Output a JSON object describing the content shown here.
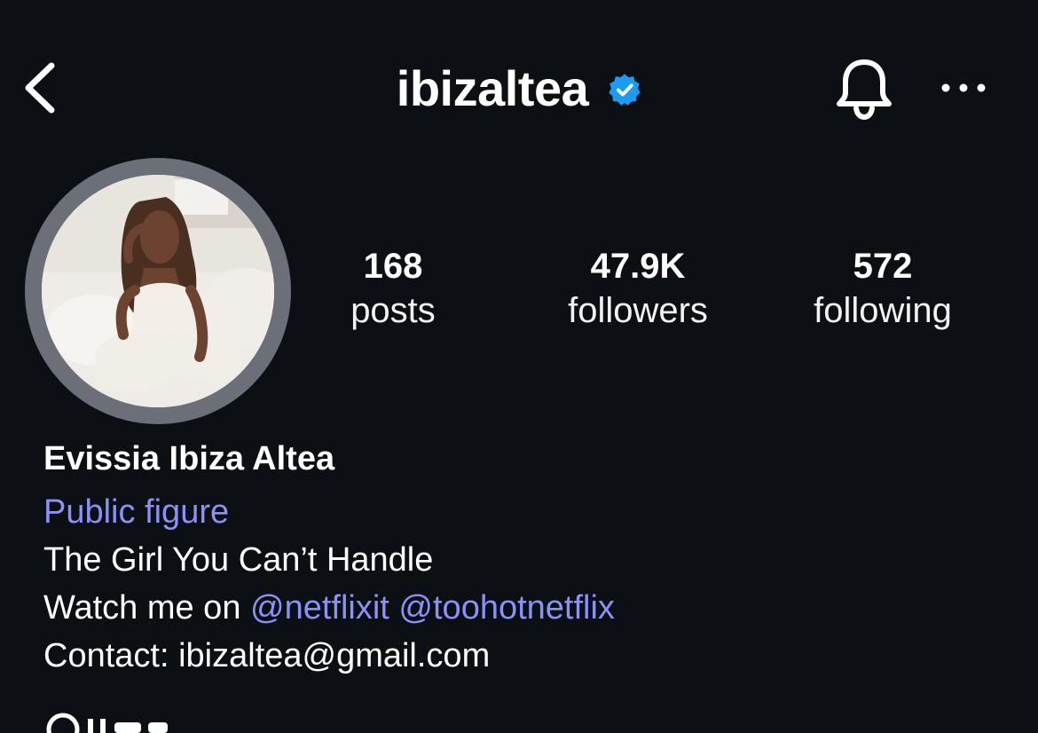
{
  "header": {
    "username": "ibizaltea",
    "verified": true,
    "icons": {
      "back": "chevron-left-icon",
      "notifications": "bell-icon",
      "more": "more-horizontal-icon",
      "verified": "verified-badge-icon"
    }
  },
  "stats": {
    "posts": {
      "value": "168",
      "label": "posts"
    },
    "followers": {
      "value": "47.9K",
      "label": "followers"
    },
    "following": {
      "value": "572",
      "label": "following"
    }
  },
  "bio": {
    "full_name": "Evissia Ibiza Altea",
    "category": "Public figure",
    "line1": "The Girl You Can’t Handle",
    "line2_prefix": "Watch me on ",
    "mention1": "@netflixit",
    "mention2": "@toohotnetflix",
    "line3": "Contact: ibizaltea@gmail.com"
  },
  "colors": {
    "background": "#0c0f14",
    "link": "#8b91f6",
    "verified_badge": "#1d9bf0",
    "avatar_ring": "#6a6f78"
  }
}
